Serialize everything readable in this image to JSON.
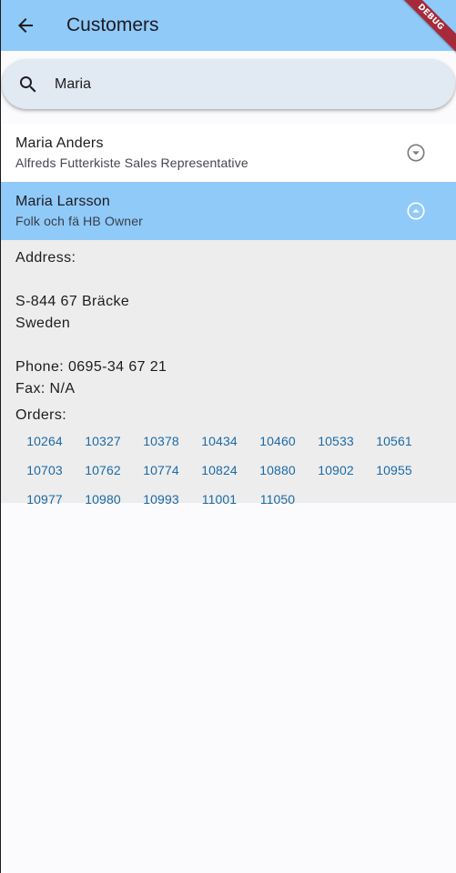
{
  "appbar": {
    "title": "Customers",
    "debug_label": "DEBUG"
  },
  "search": {
    "value": "Maria",
    "placeholder": ""
  },
  "customers": [
    {
      "name": "Maria Anders",
      "subtitle": "Alfreds Futterkiste Sales Representative",
      "expanded": false
    },
    {
      "name": "Maria Larsson",
      "subtitle": "Folk och fä HB Owner",
      "expanded": true
    }
  ],
  "details": {
    "address_label": "Address:",
    "address_line1": "S-844 67 Bräcke",
    "address_line2": "Sweden",
    "phone": "Phone: 0695-34 67 21",
    "fax": "Fax: N/A",
    "orders_label": "Orders:",
    "orders": [
      "10264",
      "10327",
      "10378",
      "10434",
      "10460",
      "10533",
      "10561",
      "10703",
      "10762",
      "10774",
      "10824",
      "10880",
      "10902",
      "10955",
      "10977",
      "10980",
      "10993",
      "11001",
      "11050"
    ]
  },
  "colors": {
    "appbar": "#90caf9",
    "selected": "#90caf9",
    "link": "#1b6aa6",
    "debug": "#a52a3a"
  }
}
